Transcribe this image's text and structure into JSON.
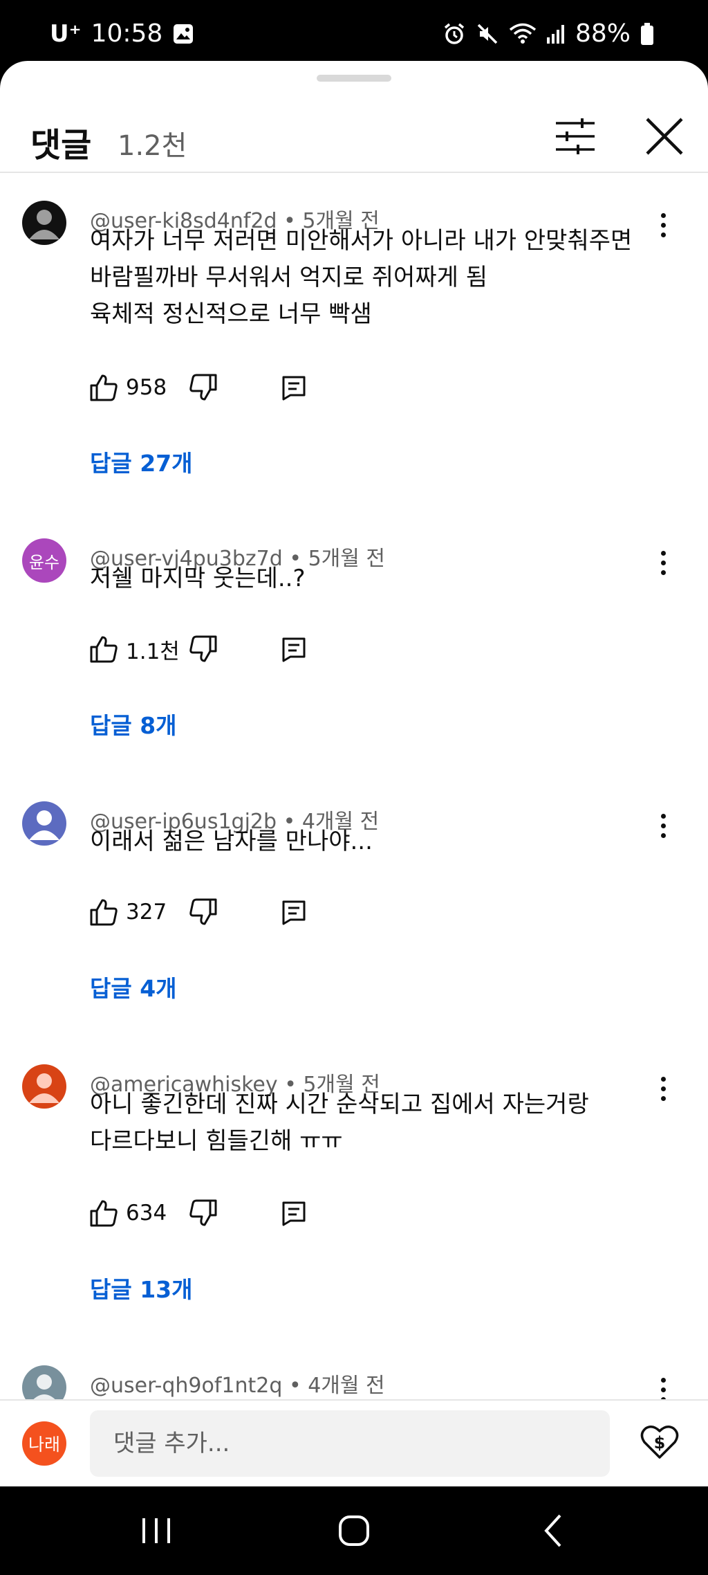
{
  "status_bar": {
    "carrier": "U⁺",
    "time": "10:58",
    "battery": "88%"
  },
  "header": {
    "title": "댓글",
    "count": "1.2천"
  },
  "comments": [
    {
      "author": "@user-ki8sd4nf2d",
      "time": "5개월 전",
      "text": "여자가 너무 저러면 미안해서가 아니라 내가 안맞춰주면\n바람필까바 무서워서 억지로 쥐어짜게 됨\n육체적 정신적으로 너무 빡샘",
      "likes": "958",
      "replies": "답글 27개",
      "avatar_color": "#111111",
      "avatar_label": ""
    },
    {
      "author": "@user-vj4pu3bz7d",
      "time": "5개월 전",
      "text": "저쉘 마지막 웃는데..?",
      "likes": "1.1천",
      "replies": "답글 8개",
      "avatar_color": "#ab47bc",
      "avatar_label": "윤수"
    },
    {
      "author": "@user-ip6us1gj2b",
      "time": "4개월 전",
      "text": "이래서 젊은 남자를 만나야...",
      "likes": "327",
      "replies": "답글 4개",
      "avatar_color": "#5c6bc0",
      "avatar_label": ""
    },
    {
      "author": "@americawhiskey",
      "time": "5개월 전",
      "text": "아니 좋긴한데 진짜 시간 순삭되고 집에서 자는거랑\n다르다보니 힘들긴해 ㅠㅠ",
      "likes": "634",
      "replies": "답글 13개",
      "avatar_color": "#d84315",
      "avatar_label": ""
    },
    {
      "author": "@user-qh9of1nt2q",
      "time": "4개월 전",
      "text": "",
      "likes": "",
      "replies": "",
      "avatar_color": "#78909c",
      "avatar_label": ""
    }
  ],
  "input": {
    "avatar_label": "나래",
    "placeholder": "댓글 추가..."
  },
  "colors": {
    "link_blue": "#065fd4",
    "secondary_text": "#606060",
    "me_avatar": "#f4511e"
  }
}
